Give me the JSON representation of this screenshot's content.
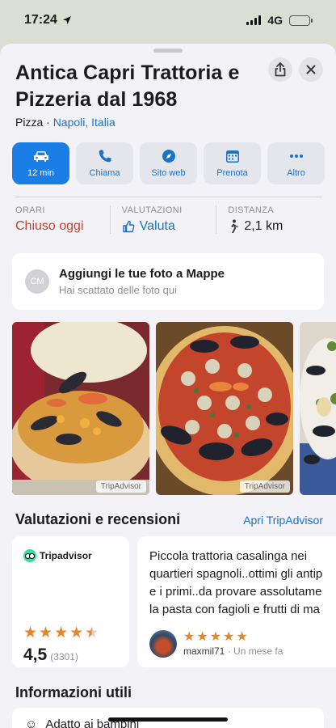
{
  "status": {
    "time": "17:24",
    "network": "4G"
  },
  "place": {
    "name": "Antica Capri Trattoria e Pizzeria dal 1968",
    "category": "Pizza",
    "separator": " · ",
    "location": "Napoli, Italia"
  },
  "actions": [
    {
      "label": "12 min",
      "icon": "car-icon"
    },
    {
      "label": "Chiama",
      "icon": "phone-icon"
    },
    {
      "label": "Sito web",
      "icon": "compass-icon"
    },
    {
      "label": "Prenota",
      "icon": "calendar-icon"
    },
    {
      "label": "Altro",
      "icon": "ellipsis-icon"
    }
  ],
  "info": {
    "hours_label": "ORARI",
    "hours_value": "Chiuso oggi",
    "ratings_label": "VALUTAZIONI",
    "ratings_value": "Valuta",
    "distance_label": "DISTANZA",
    "distance_value": "2,1 km"
  },
  "add_photos": {
    "initials": "CM",
    "title": "Aggiungi le tue foto a Mappe",
    "subtitle": "Hai scattato delle foto qui"
  },
  "photos": {
    "credit": "TripAdvisor"
  },
  "reviews": {
    "title": "Valutazioni e recensioni",
    "link": "Apri TripAdvisor",
    "provider": "Tripadvisor",
    "score": "4,5",
    "count": "(3301)",
    "rating": 4.5,
    "review_lines": [
      "Piccola trattoria casalinga nei",
      "quartieri spagnoli..ottimi gli antip",
      "e i primi..da provare assolutame",
      "la pasta con fagioli e frutti di ma"
    ],
    "review_rating": 5,
    "user": "maxmil71",
    "when": " · Un mese fa"
  },
  "useful": {
    "title": "Informazioni utili",
    "first_item": "Adatto ai bambini"
  },
  "colors": {
    "accent": "#1a7ee6",
    "closed": "#c8432f",
    "star": "#e8842a"
  }
}
